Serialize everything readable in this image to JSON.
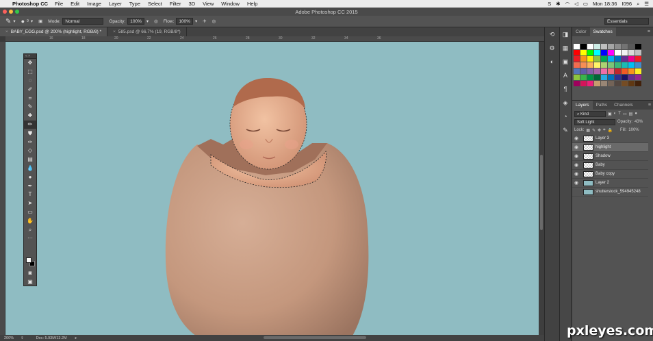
{
  "menubar": {
    "app": "Photoshop CC",
    "items": [
      "File",
      "Edit",
      "Image",
      "Layer",
      "Type",
      "Select",
      "Filter",
      "3D",
      "View",
      "Window",
      "Help"
    ],
    "clock": "Mon 18:36",
    "user": "I096"
  },
  "window": {
    "title": "Adobe Photoshop CC 2015"
  },
  "options": {
    "mode_label": "Mode:",
    "mode_value": "Normal",
    "opacity_label": "Opacity:",
    "opacity_value": "100%",
    "flow_label": "Flow:",
    "flow_value": "100%",
    "workspace": "Essentials",
    "brush_size": "9"
  },
  "tabs": [
    {
      "label": "BABY_EGG.psd @ 200% (highlight, RGB/8) *"
    },
    {
      "label": "585.psd @ 66.7% (19, RGB/8*)"
    }
  ],
  "rulers": {
    "h": [
      "16",
      "18",
      "20",
      "22",
      "24",
      "26",
      "28",
      "30",
      "32",
      "34",
      "36"
    ]
  },
  "status": {
    "zoom": "200%",
    "doc": "Doc: 5.93M/13.2M"
  },
  "swatches_panel": {
    "tabs": [
      "Color",
      "Swatches"
    ],
    "colors": [
      "#ffffff",
      "#000000",
      "#ffffff",
      "#ccece6",
      "#bfbfbf",
      "#a6a6a6",
      "#8c8c8c",
      "#737373",
      "#595959",
      "#000000",
      "#ff0000",
      "#ffff00",
      "#00ff00",
      "#00ffff",
      "#0000ff",
      "#ff00ff",
      "#ffffff",
      "#f2f2f2",
      "#d9d9d9",
      "#bfbfbf",
      "#ed1c24",
      "#f7941d",
      "#fff200",
      "#8dc63f",
      "#00a651",
      "#00aeef",
      "#0072bc",
      "#662d91",
      "#ec008c",
      "#ee1d24",
      "#f26c4f",
      "#f68e55",
      "#fbaf5c",
      "#fff467",
      "#acd372",
      "#7cc576",
      "#3bb878",
      "#1abbb4",
      "#00bff3",
      "#438ccb",
      "#5574b9",
      "#605ca8",
      "#855fa8",
      "#a763a8",
      "#f06ea9",
      "#f26d7d",
      "#c1272d",
      "#f15a24",
      "#f7931e",
      "#fcee21",
      "#8cc63f",
      "#39b54a",
      "#009245",
      "#006837",
      "#29abe2",
      "#0071bc",
      "#2e3192",
      "#1b1464",
      "#662d91",
      "#93278f",
      "#9e005d",
      "#d4145a",
      "#ed1e79",
      "#c69c6d",
      "#998675",
      "#736357",
      "#534741",
      "#754c24",
      "#603813",
      "#42210b"
    ]
  },
  "layers_panel": {
    "tabs": [
      "Layers",
      "Paths",
      "Channels"
    ],
    "kind_label": "Kind",
    "blend_mode": "Soft Light",
    "opacity_label": "Opacity:",
    "opacity_value": "43%",
    "lock_label": "Lock:",
    "fill_label": "Fill:",
    "fill_value": "100%",
    "layers": [
      {
        "name": "Layer 3",
        "selected": false,
        "visible": true
      },
      {
        "name": "highlight",
        "selected": true,
        "visible": true
      },
      {
        "name": "Shadow",
        "selected": false,
        "visible": true
      },
      {
        "name": "Baby",
        "selected": false,
        "visible": true
      },
      {
        "name": "Baby copy",
        "selected": false,
        "visible": true
      },
      {
        "name": "Layer 2",
        "selected": false,
        "visible": true
      },
      {
        "name": "shutterstock_594945248",
        "selected": false,
        "visible": false
      }
    ]
  },
  "watermark": "pxleyes.com",
  "colors": {
    "canvas_bg": "#8fbcc2",
    "egg": "#c99a80",
    "skin": "#e0a989"
  }
}
